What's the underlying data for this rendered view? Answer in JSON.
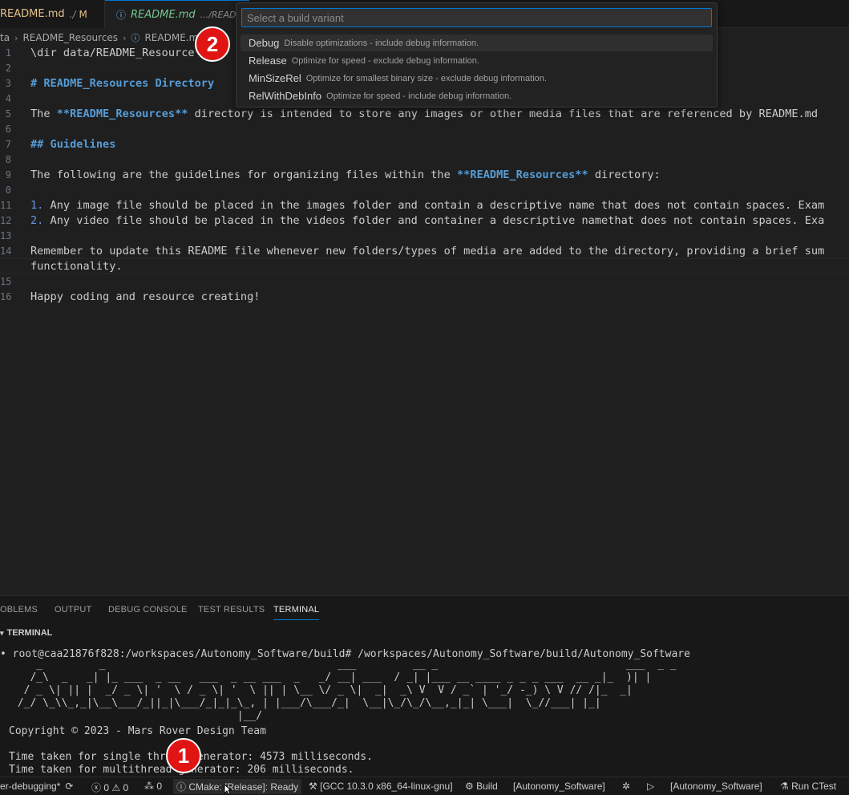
{
  "tabs": [
    {
      "name": "README.md",
      "path": "./",
      "status": "M"
    },
    {
      "name": "README.md",
      "path": ".../README_"
    }
  ],
  "breadcrumb": [
    "ta",
    "README_Resources",
    "README.m"
  ],
  "editor": {
    "lines": [
      {
        "n": "1",
        "text": "\\dir data/README_Resource"
      },
      {
        "n": "2",
        "text": ""
      },
      {
        "n": "3",
        "text": "# README_Resources Directory"
      },
      {
        "n": "4",
        "text": ""
      },
      {
        "n": "5",
        "pre": "The ",
        "bold": "**README_Resources**",
        "post": " directory is intended to store any images or other media files that are referenced by README.md"
      },
      {
        "n": "6",
        "text": ""
      },
      {
        "n": "7",
        "text": "## Guidelines"
      },
      {
        "n": "8",
        "text": ""
      },
      {
        "n": "9",
        "pre": "The following are the guidelines for organizing files within the ",
        "bold": "**README_Resources**",
        "post": " directory:"
      },
      {
        "n": "0",
        "text": ""
      },
      {
        "n": "11",
        "num": "1.",
        "text": " Any image file should be placed in the images folder and contain a descriptive name that does not contain spaces. Exam"
      },
      {
        "n": "12",
        "num": "2.",
        "text": " Any video file should be placed in the videos folder and container a descriptive namethat does not contain spaces. Exa"
      },
      {
        "n": "13",
        "text": ""
      },
      {
        "n": "14",
        "text": "Remember to update this README file whenever new folders/types of media are added to the directory, providing a brief sum"
      },
      {
        "n": "",
        "text": "functionality."
      },
      {
        "n": "15",
        "text": ""
      },
      {
        "n": "16",
        "text": "Happy coding and resource creating!"
      }
    ]
  },
  "quickpick": {
    "placeholder": "Select a build variant",
    "items": [
      {
        "label": "Debug",
        "desc": "Disable optimizations - include debug information."
      },
      {
        "label": "Release",
        "desc": "Optimize for speed - exclude debug information."
      },
      {
        "label": "MinSizeRel",
        "desc": "Optimize for smallest binary size - exclude debug information."
      },
      {
        "label": "RelWithDebInfo",
        "desc": "Optimize for speed - include debug information."
      }
    ]
  },
  "badges": {
    "one": "1",
    "two": "2"
  },
  "panel": {
    "tabs": [
      "OBLEMS",
      "OUTPUT",
      "DEBUG CONSOLE",
      "TEST RESULTS",
      "TERMINAL"
    ],
    "terminal_header": "TERMINAL",
    "prompt": "root@caa21876f828:/workspaces/Autonomy_Software/build# /workspaces/Autonomy_Software/build/Autonomy_Software",
    "ascii_art": "    _         _                                     ___         __ _                              ___  _ _\n   /_\\  _   _| |_ ___  _ __   ___  _ __ ___  _   _/ __| ___  / _| |___ __ ____ _ _ _ ___  __ _|_  )| |\n  / _ \\| || |  _/ _ \\| '  \\ / _ \\| '  \\ || | \\__ \\/ _ \\|  _|  _\\ V  V / _` | '_/ -_) \\ V // /|_  _|\n /_/ \\_\\\\_,_|\\__\\___/_||_|\\___/_|_|_\\_, | |___/\\___/_|  \\__|\\_/\\_/\\__,_|_| \\___|  \\_//___| |_|\n                                    |__/",
    "copyright": "Copyright © 2023 - Mars Rover Design Team",
    "time1": "Time taken for single thread generator: 4573 milliseconds.",
    "time2": "Time taken for multithread generator: 206 milliseconds."
  },
  "statusbar": {
    "branch": "er-debugging*",
    "errors": "0",
    "warnings": "0",
    "ports": "0",
    "cmake": "CMake: [Release]: Ready",
    "kit": "[GCC 10.3.0 x86_64-linux-gnu]",
    "build": "Build",
    "target1": "[Autonomy_Software]",
    "target2": "[Autonomy_Software]",
    "ctest": "Run CTest"
  }
}
